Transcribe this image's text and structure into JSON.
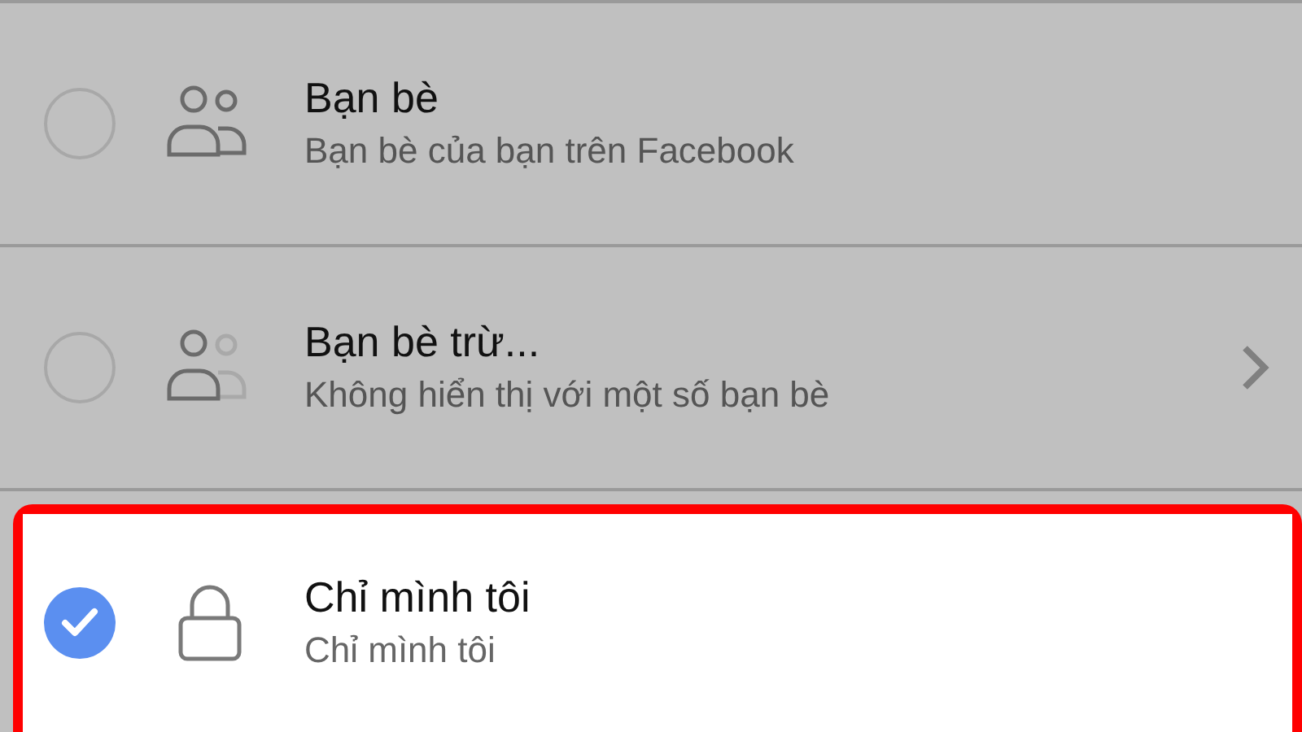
{
  "options": [
    {
      "kind": "friends",
      "title": "Bạn bè",
      "subtitle": "Bạn bè của bạn trên Facebook",
      "selected": false,
      "has_chevron": false,
      "highlighted": false
    },
    {
      "kind": "friends_except",
      "title": "Bạn bè trừ...",
      "subtitle": "Không hiển thị với một số bạn bè",
      "selected": false,
      "has_chevron": true,
      "highlighted": false
    },
    {
      "kind": "lock",
      "title": "Chỉ mình tôi",
      "subtitle": "Chỉ mình tôi",
      "selected": true,
      "has_chevron": false,
      "highlighted": true
    }
  ]
}
